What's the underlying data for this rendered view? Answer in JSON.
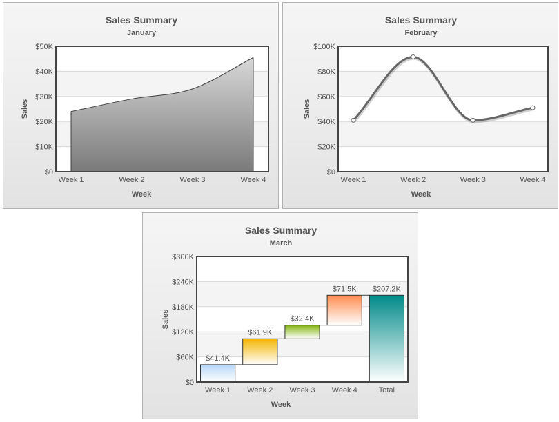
{
  "chart_data": [
    {
      "type": "area",
      "title": "Sales Summary",
      "subtitle": "January",
      "xlabel": "Week",
      "ylabel": "Sales",
      "categories": [
        "Week 1",
        "Week 2",
        "Week 3",
        "Week 4"
      ],
      "values": [
        24,
        29,
        33,
        45.5
      ],
      "ylim": [
        0,
        50
      ],
      "yticks": [
        "$0",
        "$10K",
        "$20K",
        "$30K",
        "$40K",
        "$50K"
      ],
      "grid": true,
      "colors": {
        "fill_top": "#d8d8d8",
        "fill_bottom": "#7a7a7a",
        "line": "#3f3f3f"
      }
    },
    {
      "type": "line",
      "title": "Sales Summary",
      "subtitle": "February",
      "xlabel": "Week",
      "ylabel": "Sales",
      "categories": [
        "Week 1",
        "Week 2",
        "Week 3",
        "Week 4"
      ],
      "values": [
        41,
        91.5,
        41,
        51
      ],
      "ylim": [
        0,
        100
      ],
      "yticks": [
        "$0",
        "$20K",
        "$40K",
        "$60K",
        "$80K",
        "$100K"
      ],
      "grid": true,
      "smooth": true,
      "colors": {
        "line": "#666666",
        "marker_fill": "#ffffff"
      }
    },
    {
      "type": "bar",
      "subtype": "waterfall",
      "title": "Sales Summary",
      "subtitle": "March",
      "xlabel": "Week",
      "ylabel": "Sales",
      "categories": [
        "Week 1",
        "Week 2",
        "Week 3",
        "Week 4",
        "Total"
      ],
      "values": [
        41.4,
        61.9,
        32.4,
        71.5,
        207.2
      ],
      "data_labels": [
        "$41.4K",
        "$61.9K",
        "$32.4K",
        "$71.5K",
        "$207.2K"
      ],
      "ylim": [
        0,
        300
      ],
      "yticks": [
        "$0",
        "$60K",
        "$120K",
        "$180K",
        "$240K",
        "$300K"
      ],
      "grid": true,
      "colors": {
        "bars": [
          [
            "#b7d6f7",
            "#ffffff"
          ],
          [
            "#f3b600",
            "#ffffff"
          ],
          [
            "#85b511",
            "#ffffff"
          ],
          [
            "#ff8c4f",
            "#ffffff"
          ],
          [
            "#028a8a",
            "#ffffff"
          ]
        ],
        "connector": "#444444"
      }
    }
  ]
}
